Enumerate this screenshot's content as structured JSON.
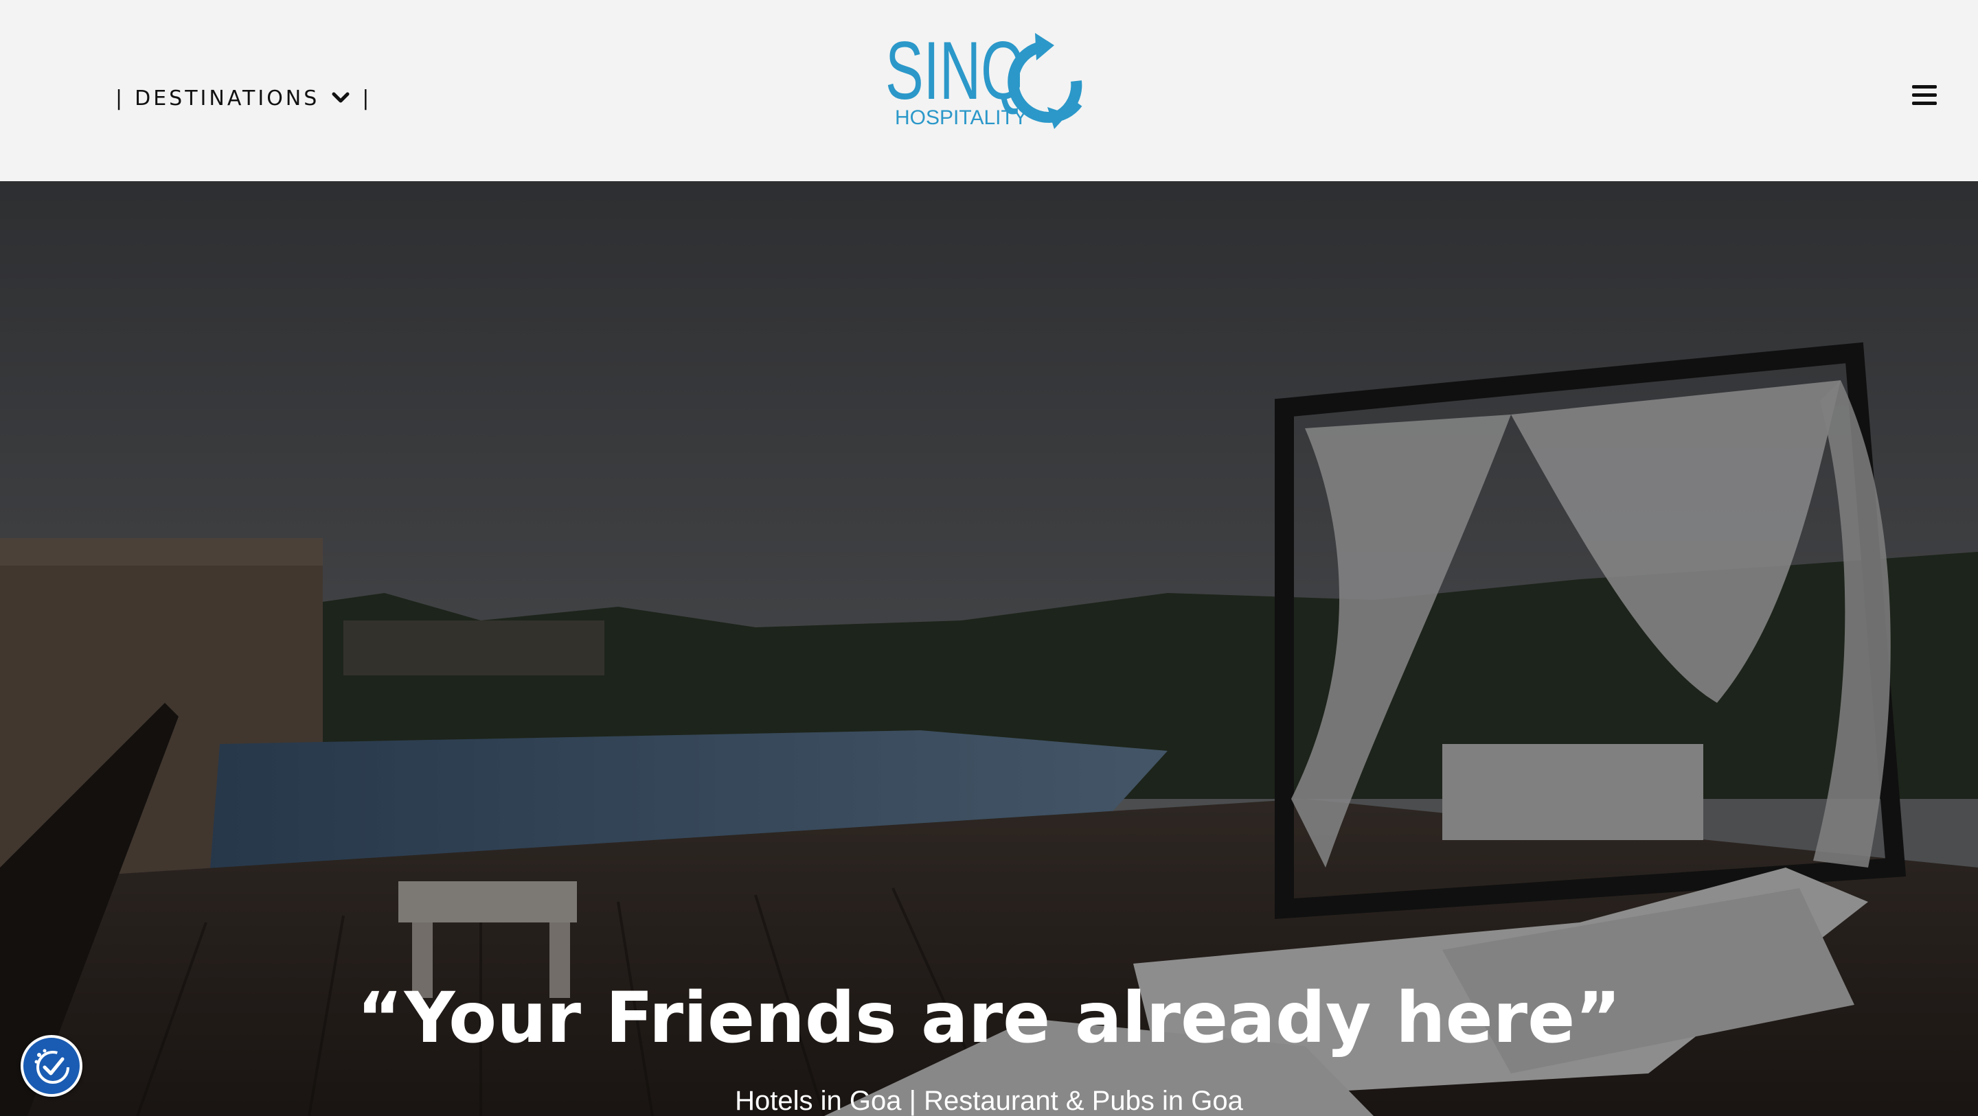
{
  "header": {
    "destinations_label": "DESTINATIONS",
    "separator": "|",
    "logo": {
      "brand": "SINQ",
      "tagline": "HOSPITALITY",
      "color": "#2b98c9"
    }
  },
  "hero": {
    "title": "“Your Friends are already here”",
    "subtitle": "Hotels in Goa | Restaurant & Pubs in Goa"
  },
  "icons": {
    "menu": "hamburger-icon",
    "dropdown": "chevron-down-icon",
    "accessibility": "accessibility-icon"
  },
  "colors": {
    "header_bg": "#f3f3f3",
    "accent": "#2b98c9",
    "a11y_button": "#1a5cb3"
  }
}
